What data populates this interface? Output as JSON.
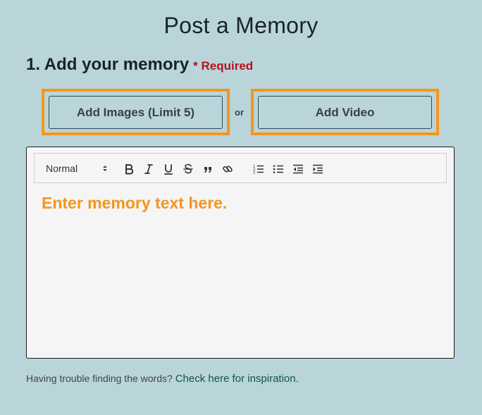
{
  "page": {
    "title": "Post a Memory"
  },
  "section": {
    "heading": "1. Add your memory",
    "required_label": "* Required"
  },
  "media": {
    "add_images_label": "Add Images (Limit 5)",
    "separator": "or",
    "add_video_label": "Add Video",
    "highlight_color": "#f4961e"
  },
  "editor": {
    "format_select": {
      "selected": "Normal"
    },
    "toolbar_icons": [
      "bold-icon",
      "italic-icon",
      "underline-icon",
      "strikethrough-icon",
      "blockquote-icon",
      "link-icon",
      "ordered-list-icon",
      "bullet-list-icon",
      "outdent-icon",
      "indent-icon"
    ],
    "placeholder": "Enter memory text here.",
    "placeholder_color": "#f4961e"
  },
  "help": {
    "prompt": "Having trouble finding the words?",
    "link_text": "Check here for inspiration.",
    "link_color": "#0f5542"
  },
  "colors": {
    "background": "#bad5d9",
    "required": "#b2131e"
  }
}
